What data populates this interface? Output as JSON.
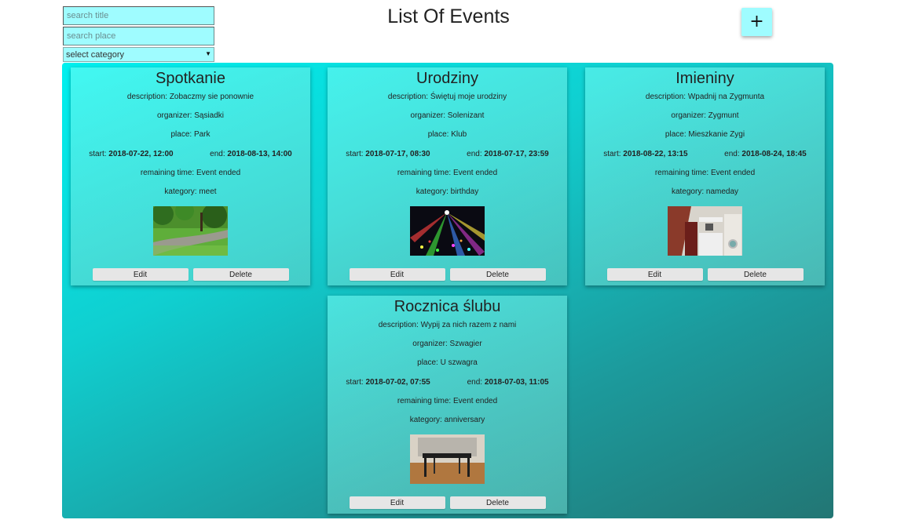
{
  "filters": {
    "title_placeholder": "search title",
    "place_placeholder": "search place",
    "category_selected": "select category"
  },
  "header": {
    "title": "List Of Events",
    "add_label": "+"
  },
  "labels": {
    "description": "description: ",
    "organizer": "organizer: ",
    "place": "place: ",
    "start": "start: ",
    "end": "end: ",
    "remaining": "remaining time: ",
    "category": "kategory: ",
    "edit": "Edit",
    "delete": "Delete"
  },
  "events": [
    {
      "title": "Spotkanie",
      "description": "Zobaczmy sie ponownie",
      "organizer": "Sąsiadki",
      "place": "Park",
      "start": "2018-07-22, 12:00",
      "end": "2018-08-13, 14:00",
      "remaining": "Event ended",
      "category": "meet",
      "image": "park-path-photo"
    },
    {
      "title": "Urodziny",
      "description": "Świętuj moje urodziny",
      "organizer": "Solenizant",
      "place": "Klub",
      "start": "2018-07-17, 08:30",
      "end": "2018-07-17, 23:59",
      "remaining": "Event ended",
      "category": "birthday",
      "image": "disco-lights-photo"
    },
    {
      "title": "Imieniny",
      "description": "Wpadnij na Zygmunta",
      "organizer": "Zygmunt",
      "place": "Mieszkanie Zygi",
      "start": "2018-08-22, 13:15",
      "end": "2018-08-24, 18:45",
      "remaining": "Event ended",
      "category": "nameday",
      "image": "kitchen-photo"
    },
    {
      "title": "Rocznica ślubu",
      "description": "Wypij za nich razem z nami",
      "organizer": "Szwagier",
      "place": "U szwagra",
      "start": "2018-07-02, 07:55",
      "end": "2018-07-03, 11:05",
      "remaining": "Event ended",
      "category": "anniversary",
      "image": "dining-table-photo"
    }
  ]
}
